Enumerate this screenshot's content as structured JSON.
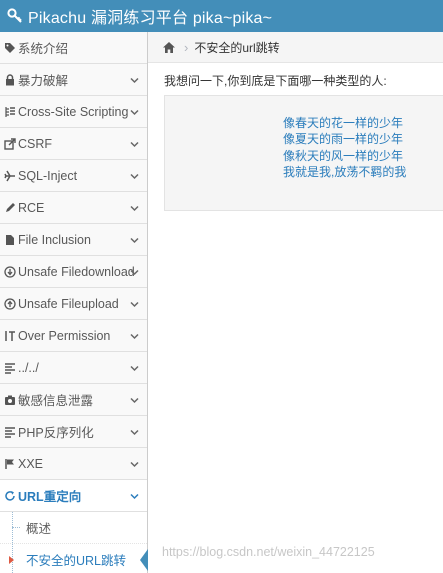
{
  "app": {
    "brand": "Pikachu 漏洞练习平台 pika~pika~"
  },
  "sidebar": {
    "items": [
      {
        "label": "系统介绍",
        "icon": "tag-icon",
        "has_chevron": false
      },
      {
        "label": "暴力破解",
        "icon": "lock-icon",
        "has_chevron": true
      },
      {
        "label": "Cross-Site Scripting",
        "icon": "list-tree-icon",
        "has_chevron": true
      },
      {
        "label": "CSRF",
        "icon": "share-icon",
        "has_chevron": true
      },
      {
        "label": "SQL-Inject",
        "icon": "plane-icon",
        "has_chevron": true
      },
      {
        "label": "RCE",
        "icon": "pencil-icon",
        "has_chevron": true
      },
      {
        "label": "File Inclusion",
        "icon": "file-icon",
        "has_chevron": true
      },
      {
        "label": "Unsafe Filedownload",
        "icon": "download-icon",
        "has_chevron": true
      },
      {
        "label": "Unsafe Fileupload",
        "icon": "upload-icon",
        "has_chevron": true
      },
      {
        "label": "Over Permission",
        "icon": "text-cursor-icon",
        "has_chevron": true
      },
      {
        "label": "../../",
        "icon": "align-left-icon",
        "has_chevron": true
      },
      {
        "label": "敏感信息泄露",
        "icon": "camera-icon",
        "has_chevron": true
      },
      {
        "label": "PHP反序列化",
        "icon": "align-left-icon",
        "has_chevron": true
      },
      {
        "label": "XXE",
        "icon": "flag-icon",
        "has_chevron": true
      },
      {
        "label": "URL重定向",
        "icon": "refresh-icon",
        "has_chevron": true,
        "open": true
      }
    ],
    "submenu": [
      {
        "label": "概述",
        "active": false
      },
      {
        "label": "不安全的URL跳转",
        "active": true
      }
    ]
  },
  "breadcrumb": {
    "current": "不安全的url跳转"
  },
  "content": {
    "question": "我想问一下,你到底是下面哪一种类型的人:",
    "answers": [
      "像春天的花一样的少年",
      "像夏天的雨一样的少年",
      "像秋天的风一样的少年",
      "我就是我,放荡不羁的我"
    ]
  },
  "watermark": "https://blog.csdn.net/weixin_44722125",
  "colors": {
    "navbar": "#438eb9",
    "link": "#2b7dbc",
    "active_caret": "#dd5a43"
  }
}
